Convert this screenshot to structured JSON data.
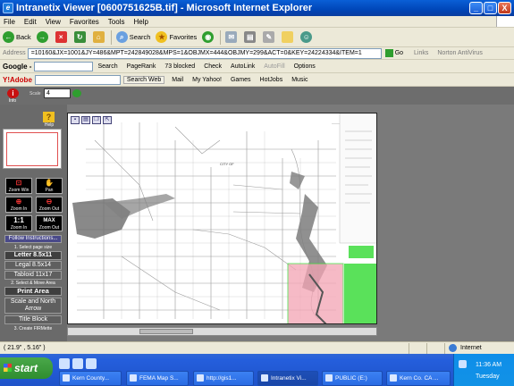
{
  "window": {
    "title": "Intranetix Viewer [0600751625B.tif] - Microsoft Internet Explorer",
    "min": "_",
    "max": "□",
    "close": "X"
  },
  "menu": [
    "File",
    "Edit",
    "View",
    "Favorites",
    "Tools",
    "Help"
  ],
  "toolbar": {
    "back": "Back",
    "search": "Search",
    "favorites": "Favorites"
  },
  "address": {
    "label": "Address",
    "url": "=10160&JX=1001&JY=486&MPT=242849028&MPS=1&OBJMX=444&OBJMY=299&ACT=0&KEY=24224334&ITEM=1",
    "go": "Go",
    "links": "Links",
    "antivirus": "Norton AntiVirus"
  },
  "google": {
    "logo": "Google -",
    "search": "Search",
    "pagerank": "PageRank",
    "blocked": "73 blocked",
    "check": "Check",
    "autolink": "AutoLink",
    "autofill": "AutoFill",
    "options": "Options"
  },
  "yahoo": {
    "logo": "Y!Adobe",
    "search_web": "Search Web",
    "mail": "Mail",
    "my_yahoo": "My Yahoo!",
    "games": "Games",
    "hotjobs": "HotJobs",
    "music": "Music"
  },
  "viewer": {
    "info": "Info",
    "scale_label": "Scale",
    "scale_value": "4",
    "help": "Help",
    "tools": {
      "zoom_win": "Zoom Win",
      "pan": "Pan",
      "zoom_in": "Zoom In",
      "zoom_out": "Zoom Out",
      "one_to_one": "1:1",
      "one_to_one_sub": "Zoom In",
      "max": "MAX",
      "max_sub": "Zoom Out"
    },
    "follow": "Follow Instructions...",
    "step1": "1. Select page size",
    "letter": "Letter 8.5x11",
    "legal": "Legal 8.5x14",
    "tabloid": "Tabloid 11x17",
    "step2": "2. Select & Move Area",
    "print_area": "Print Area",
    "scale_north": "Scale and North Arrow",
    "title_block": "Title Block",
    "step3": "3. Create FIRMette"
  },
  "status": {
    "coords": "( 21.9\" , 5.16\" )",
    "zone": "Internet"
  },
  "taskbar": {
    "start": "start",
    "tasks": [
      "Kern County...",
      "FEMA Map S...",
      "http://gis1...",
      "Intranetix Vi...",
      "PUBLIC (E:)",
      "Kern Co. CA ..."
    ],
    "time": "11:36 AM",
    "day": "Tuesday"
  },
  "colors": {
    "titlebar": "#0046b8",
    "selection_pink": "#f4a4b4",
    "selection_green": "#3ddc3d",
    "viewer_gray": "#7a7a7a"
  }
}
